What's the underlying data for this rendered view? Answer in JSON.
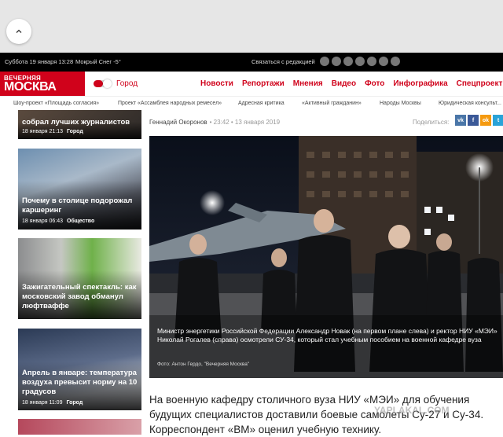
{
  "infobar": {
    "date": "Суббота 19 января 13:28",
    "weather": "Мокрый Снег -5°",
    "contact": "Связаться с редакцией"
  },
  "logo": {
    "line1": "ВЕЧЕРНЯЯ",
    "line2": "МОСКВА"
  },
  "nav": {
    "city": "Город",
    "links": [
      "Новости",
      "Репортажи",
      "Мнения",
      "Видео",
      "Фото",
      "Инфографика",
      "Спецпроекты",
      "Ру"
    ]
  },
  "subnav": [
    "Шоу-проект «Площадь согласия»",
    "Проект «Ассамблея народных ремесел»",
    "Адресная критика",
    "«Активный гражданин»",
    "Народы Москвы",
    "Юридическая консульт..."
  ],
  "sidebar": [
    {
      "title": "собрал лучших журналистов",
      "time": "18 января 21:13",
      "tag": "Город"
    },
    {
      "title": "Почему в столице подорожал каршеринг",
      "time": "18 января 06:43",
      "tag": "Общество"
    },
    {
      "title": "Зажигательный спектакль: как московский завод обманул люфтваффе",
      "time": "",
      "tag": ""
    },
    {
      "title": "Апрель в январе: температура воздуха превысит норму на 10 градусов",
      "time": "18 января 11:09",
      "tag": "Город"
    }
  ],
  "article": {
    "author": "Геннадий Окоронов",
    "time": "• 23:42 • 13 января 2019",
    "share_label": "Поделиться:",
    "share": [
      "vk",
      "f",
      "ok",
      "t"
    ],
    "caption": "Министр энергетики Российской Федерации Александр Новак (на первом плане слева) и ректор НИУ «МЭИ» Николай Рогалев (справа) осмотрели СУ-34, который стал учебным пособием на военной кафедре вуза",
    "photo_credit": "Фото: Антон Гердо, \"Вечерняя Москва\"",
    "lead": "На военную кафедру столичного вуза НИУ «МЭИ» для обучения будущих специалистов доставили боевые самолеты Су-27 и Су-34. Корреспондент «ВМ» оценил учебную технику.",
    "watermark": "YAPLAKAL.COM"
  },
  "colors": {
    "brand": "#d0021b",
    "infobar": "#000000"
  }
}
